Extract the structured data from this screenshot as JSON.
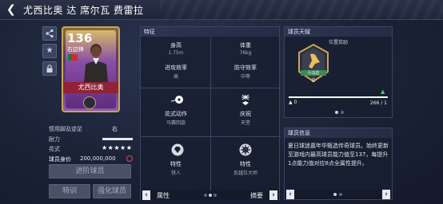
{
  "header": {
    "title": "尤西比奥 达 席尔瓦 费雷拉",
    "back_icon": "chevron-left-icon"
  },
  "card": {
    "rating": "136",
    "position": "右边锋",
    "name": "尤西比奥"
  },
  "left_stats": {
    "preferred_foot_label": "惯用脚及逆足",
    "preferred_foot_value": "右",
    "stamina_label": "耐力",
    "stamina_level": 1.0,
    "skill_label": "花式",
    "skill_stars": "★★★★★",
    "value_label": "球员身价",
    "value": "200,000,000",
    "primary_button": "进阶球员",
    "train_button": "特训",
    "strengthen_button": "强化球员"
  },
  "traits_panel": {
    "title": "特征",
    "height_label": "身高",
    "height_value": "1.75m",
    "weight_label": "体重",
    "weight_value": "76kg",
    "attack_label": "进攻效率",
    "attack_value": "高",
    "defense_label": "防守效率",
    "defense_value": "中等",
    "skill_move_label": "花式动作",
    "skill_move_value": "马赛回旋",
    "celebration_label": "庆祝",
    "celebration_value": "天堂",
    "trait1_label": "特性",
    "trait1_value": "铁人",
    "trait2_label": "特性",
    "trait2_value": "反越位大师",
    "footer_left": "属性",
    "footer_right": "摘要"
  },
  "talent_panel": {
    "title": "球员天赋",
    "subtitle": "位置奖励",
    "badge_label": "小马达",
    "badge_level": "0",
    "progress_left": "0",
    "progress_right": "266 / 1",
    "progress_fraction": 0.0
  },
  "info_panel": {
    "title": "球员信息",
    "description": "夏日球迷嘉年华甄选传奇球员。始终更新至游戏内最高球员能力值至137，每提升1点能力值对应8点全属性提升。"
  },
  "colors": {
    "accent_gold": "#c9a557",
    "panel_bg": "#181e30",
    "highlight_green": "#3fd070"
  }
}
